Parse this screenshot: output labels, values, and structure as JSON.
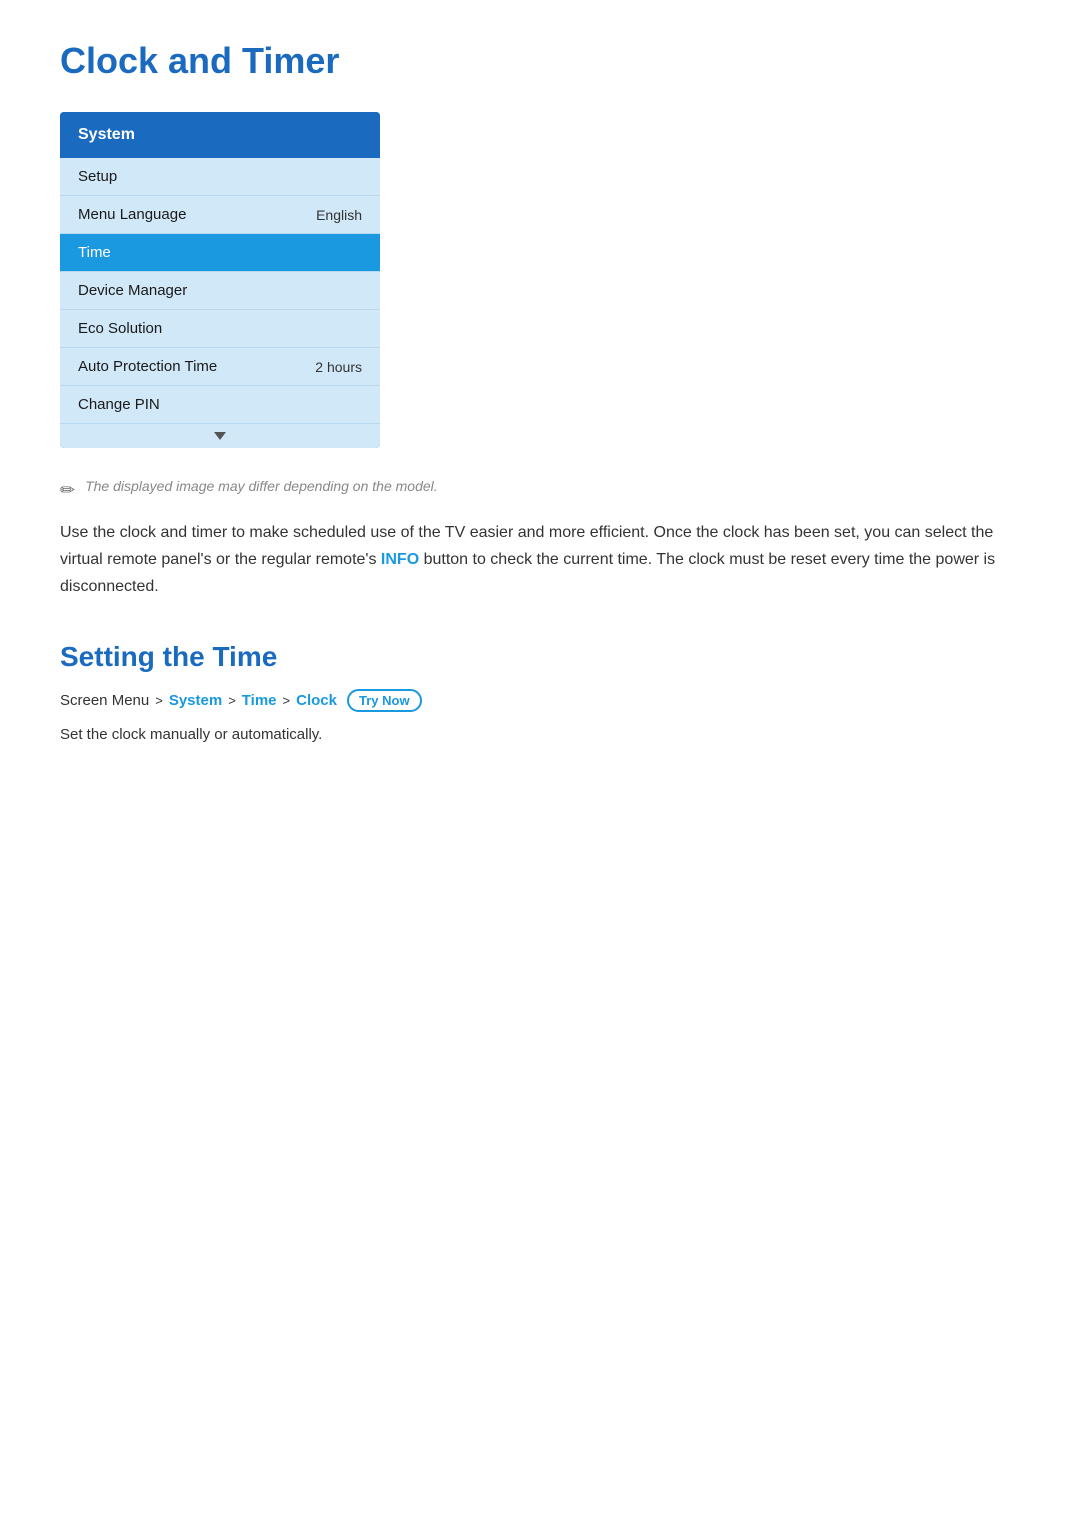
{
  "page": {
    "title": "Clock and Timer"
  },
  "menu": {
    "header": "System",
    "items": [
      {
        "label": "Setup",
        "value": "",
        "active": false
      },
      {
        "label": "Menu Language",
        "value": "English",
        "active": false
      },
      {
        "label": "Time",
        "value": "",
        "active": true
      },
      {
        "label": "Device Manager",
        "value": "",
        "active": false
      },
      {
        "label": "Eco Solution",
        "value": "",
        "active": false
      },
      {
        "label": "Auto Protection Time",
        "value": "2 hours",
        "active": false
      },
      {
        "label": "Change PIN",
        "value": "",
        "active": false
      }
    ]
  },
  "note": {
    "icon": "✏",
    "text": "The displayed image may differ depending on the model."
  },
  "description": {
    "text_before": "Use the clock and timer to make scheduled use of the TV easier and more efficient. Once the clock has been set, you can select the virtual remote panel's or the regular remote's ",
    "highlight": "INFO",
    "text_after": " button to check the current time. The clock must be reset every time the power is disconnected."
  },
  "section": {
    "title": "Setting the Time",
    "breadcrumb": {
      "prefix": "Screen Menu",
      "sep1": ">",
      "link1": "System",
      "sep2": ">",
      "link2": "Time",
      "sep3": ">",
      "link3": "Clock",
      "try_now_label": "Try Now"
    },
    "sub_description": "Set the clock manually or automatically."
  }
}
